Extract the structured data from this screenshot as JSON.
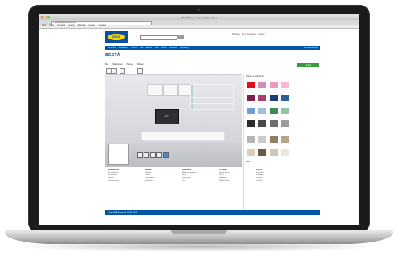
{
  "browser": {
    "window_title": "BESTÅ planeringsverktyg – IKEA",
    "url": "http://www.ikea.com/se",
    "bookmarks": [
      "IKEA",
      "Apple",
      "Facebook",
      "Google",
      "Wikipedia",
      "Nyheter",
      "Populära"
    ]
  },
  "header": {
    "logo_text": "IKEA",
    "search_button": "Sök",
    "links": [
      "Produkter",
      "Rum",
      "Kampanjer",
      "Logga in"
    ]
  },
  "nav": {
    "items": [
      "Sortiment",
      "Vardagsrum",
      "Sovrum",
      "Kök",
      "Badrum",
      "Barn",
      "Kontor",
      "Förvaring",
      "Belysning",
      "Alla avdelningar"
    ]
  },
  "planner": {
    "brand": "BESTÅ",
    "tabs": [
      "Bas",
      "Skåpstorlek",
      "Planera",
      "Montera"
    ],
    "tv_label": "47\"",
    "save_button": "Spara",
    "palette_heading": "Färger på alla dörrar",
    "palette_subheading": "Alla",
    "swatch_colors": [
      "#e60e1a",
      "#d38cb8",
      "#ef9ac2",
      "#f6b9cf",
      "#7d1e4b",
      "#ad3e73",
      "#1b3c7a",
      "#2e5f97",
      "#6f9fd0",
      "#9cc3d9",
      "#3f8a55",
      "#8fc4a5",
      "#2a2a2a",
      "#4a4a4a",
      "#6e6e6e",
      "#9c9c9c",
      "#b5b5b5",
      "#cacaca",
      "#8f7e64",
      "#b8a68a",
      "#d8d0bf",
      "#6c5a44",
      "#cfc6b6",
      "#ece7dd"
    ]
  },
  "footer": {
    "columns": [
      {
        "heading": "Kundservice",
        "items": [
          "Kontakta oss",
          "Leveranser",
          "Returer",
          "Vanliga frågor"
        ]
      },
      {
        "heading": "Handla",
        "items": [
          "Varuhus",
          "Online",
          "Presentkort",
          "Kampanjer"
        ]
      },
      {
        "heading": "Inspiration",
        "items": [
          "Planeringsverktyg",
          "Rum",
          "Broschyrer",
          "Tips"
        ]
      },
      {
        "heading": "Om IKEA",
        "items": [
          "Jobba hos oss",
          "Press",
          "Hållbarhet",
          "IKEA Family"
        ]
      },
      {
        "heading": "Följ oss",
        "items": [
          "Facebook",
          "Instagram",
          "Pinterest",
          "YouTube"
        ]
      }
    ],
    "copyright": "© Inter IKEA Systems B.V. 1999–2013"
  }
}
